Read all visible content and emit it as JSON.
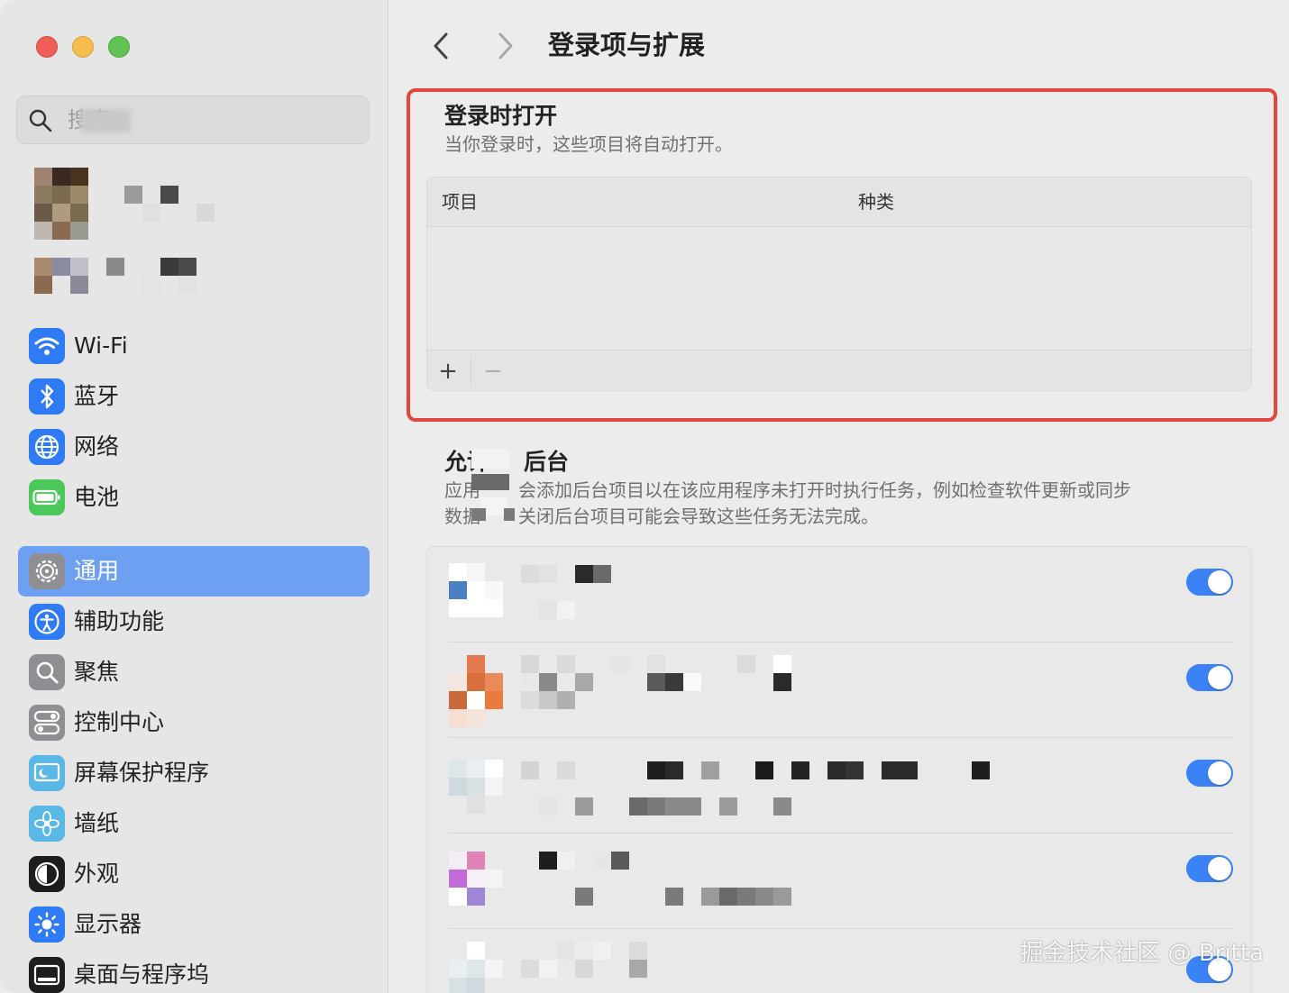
{
  "window": {
    "title": "登录项与扩展"
  },
  "sidebar": {
    "search_placeholder": "搜索",
    "items": [
      {
        "label": "Wi-Fi",
        "icon": "wifi-icon",
        "color": "#2f7bf5"
      },
      {
        "label": "蓝牙",
        "icon": "bluetooth-icon",
        "color": "#2f7bf5"
      },
      {
        "label": "网络",
        "icon": "globe-icon",
        "color": "#2f7bf5"
      },
      {
        "label": "电池",
        "icon": "battery-icon",
        "color": "#4cc75a"
      },
      {
        "label": "通用",
        "icon": "gear-icon",
        "color": "#8e8e93",
        "selected": true
      },
      {
        "label": "辅助功能",
        "icon": "accessibility-icon",
        "color": "#2f7bf5"
      },
      {
        "label": "聚焦",
        "icon": "magnifier-icon",
        "color": "#8e8e93"
      },
      {
        "label": "控制中心",
        "icon": "toggles-icon",
        "color": "#8e8e93"
      },
      {
        "label": "屏幕保护程序",
        "icon": "screensaver-icon",
        "color": "#5ab8e6"
      },
      {
        "label": "墙纸",
        "icon": "flower-icon",
        "color": "#5ab8e6"
      },
      {
        "label": "外观",
        "icon": "appearance-icon",
        "color": "#1d1d1f"
      },
      {
        "label": "显示器",
        "icon": "brightness-icon",
        "color": "#2f7bf5"
      },
      {
        "label": "桌面与程序坞",
        "icon": "dock-icon",
        "color": "#1d1d1f"
      }
    ]
  },
  "main": {
    "login_section": {
      "title": "登录时打开",
      "subtitle": "当你登录时，这些项目将自动打开。",
      "columns": [
        "项目",
        "种类"
      ],
      "add_label": "+",
      "remove_label": "−"
    },
    "background_section": {
      "title_visible_parts": [
        "允许",
        "后台"
      ],
      "subtitle_line1_parts": [
        "应用",
        "会添加后台项目以在该应用程序未打开时执行任务，例如检查软件更新或同步"
      ],
      "subtitle_line2_parts": [
        "数据",
        "关闭后台项目可能会导致这些任务无法完成。"
      ],
      "rows": [
        {
          "enabled": true
        },
        {
          "enabled": true
        },
        {
          "enabled": true
        },
        {
          "enabled": true
        },
        {
          "enabled": true
        }
      ]
    }
  },
  "watermark": "掘金技术社区 @ Britta",
  "accent_color": "#3b82f6",
  "highlight_color": "#e3463a"
}
